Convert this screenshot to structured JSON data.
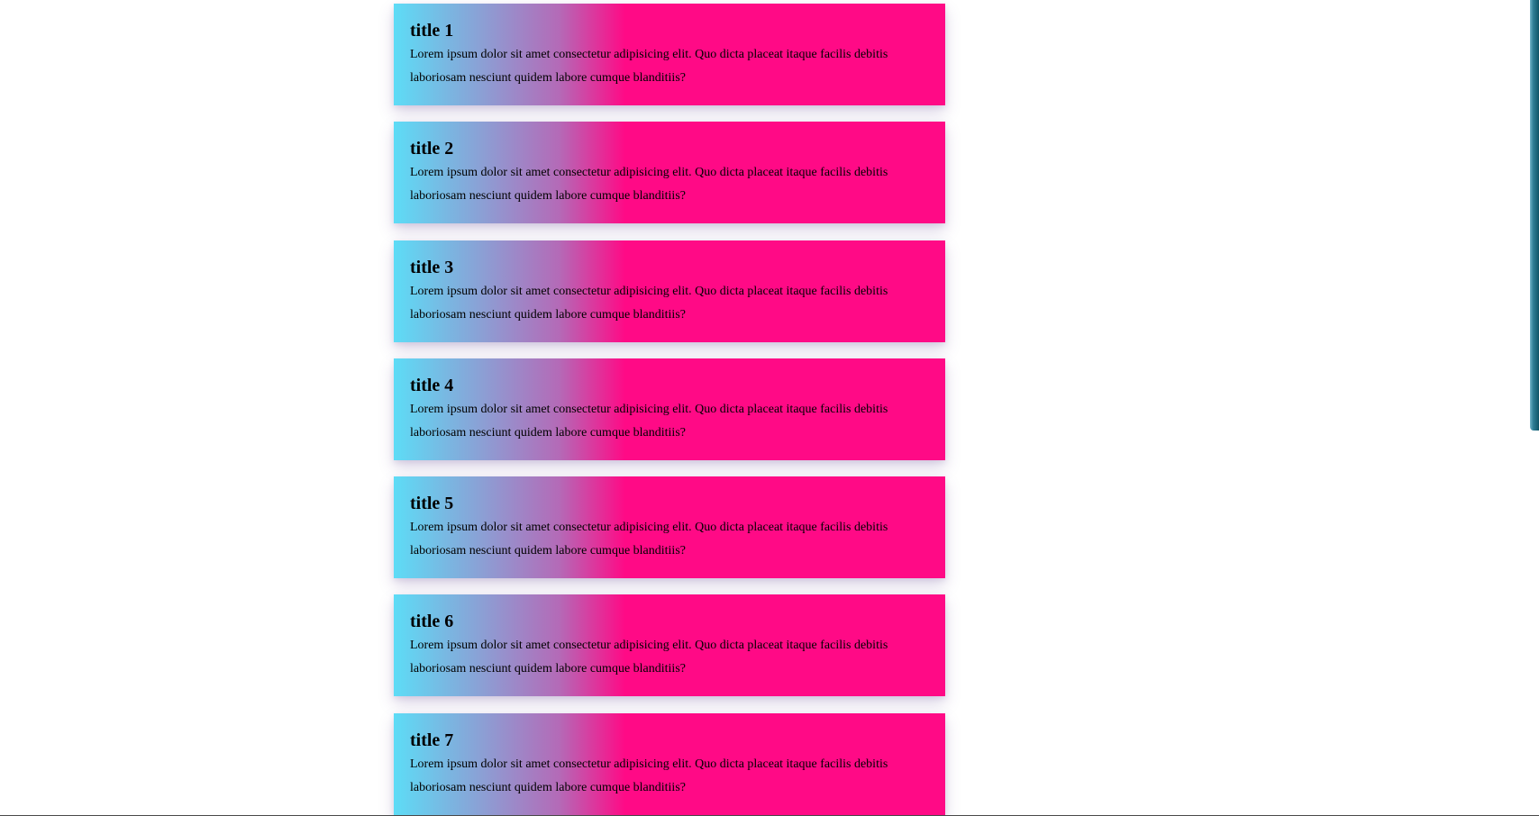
{
  "theme": {
    "gradient_start": "#5ddcf6",
    "gradient_mid": "#b46ab7",
    "gradient_end": "#ff0a86"
  },
  "cards": [
    {
      "title": "title 1",
      "text": "Lorem ipsum dolor sit amet consectetur adipisicing elit. Quo dicta placeat itaque facilis debitis laboriosam nesciunt quidem labore cumque blanditiis?"
    },
    {
      "title": "title 2",
      "text": "Lorem ipsum dolor sit amet consectetur adipisicing elit. Quo dicta placeat itaque facilis debitis laboriosam nesciunt quidem labore cumque blanditiis?"
    },
    {
      "title": "title 3",
      "text": "Lorem ipsum dolor sit amet consectetur adipisicing elit. Quo dicta placeat itaque facilis debitis laboriosam nesciunt quidem labore cumque blanditiis?"
    },
    {
      "title": "title 4",
      "text": "Lorem ipsum dolor sit amet consectetur adipisicing elit. Quo dicta placeat itaque facilis debitis laboriosam nesciunt quidem labore cumque blanditiis?"
    },
    {
      "title": "title 5",
      "text": "Lorem ipsum dolor sit amet consectetur adipisicing elit. Quo dicta placeat itaque facilis debitis laboriosam nesciunt quidem labore cumque blanditiis?"
    },
    {
      "title": "title 6",
      "text": "Lorem ipsum dolor sit amet consectetur adipisicing elit. Quo dicta placeat itaque facilis debitis laboriosam nesciunt quidem labore cumque blanditiis?"
    },
    {
      "title": "title 7",
      "text": "Lorem ipsum dolor sit amet consectetur adipisicing elit. Quo dicta placeat itaque facilis debitis laboriosam nesciunt quidem labore cumque blanditiis?"
    }
  ]
}
